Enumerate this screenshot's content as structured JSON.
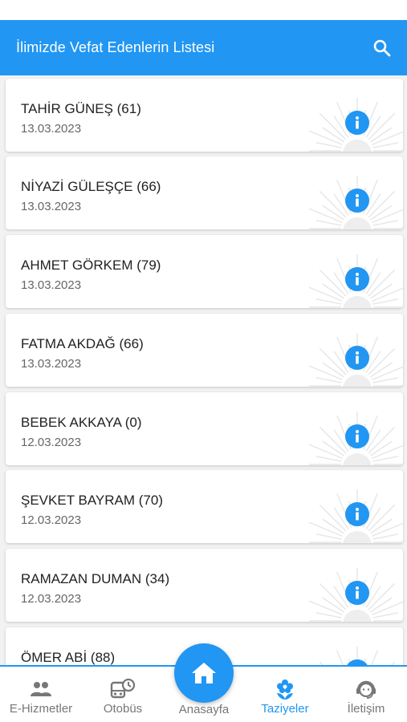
{
  "app_bar": {
    "title": "İlimizde Vefat Edenlerin Listesi",
    "search_icon": "search-icon"
  },
  "deaths": [
    {
      "name": "TAHİR GÜNEŞ (61)",
      "date": "13.03.2023"
    },
    {
      "name": "NİYAZİ GÜLEŞÇE (66)",
      "date": "13.03.2023"
    },
    {
      "name": "AHMET GÖRKEM (79)",
      "date": "13.03.2023"
    },
    {
      "name": "FATMA AKDAĞ (66)",
      "date": "13.03.2023"
    },
    {
      "name": "BEBEK AKKAYA (0)",
      "date": "12.03.2023"
    },
    {
      "name": "ŞEVKET BAYRAM (70)",
      "date": "12.03.2023"
    },
    {
      "name": "RAMAZAN DUMAN (34)",
      "date": "12.03.2023"
    },
    {
      "name": "ÖMER ABİ (88)",
      "date": ""
    }
  ],
  "bottom_nav": {
    "e_hizmetler": "E-Hizmetler",
    "otobus": "Otobüs",
    "anasayfa": "Anasayfa",
    "taziyeler": "Taziyeler",
    "iletisim": "İletişim"
  },
  "colors": {
    "primary": "#2196f3",
    "active_nav": "#2196f3",
    "inactive_nav": "#777777"
  }
}
